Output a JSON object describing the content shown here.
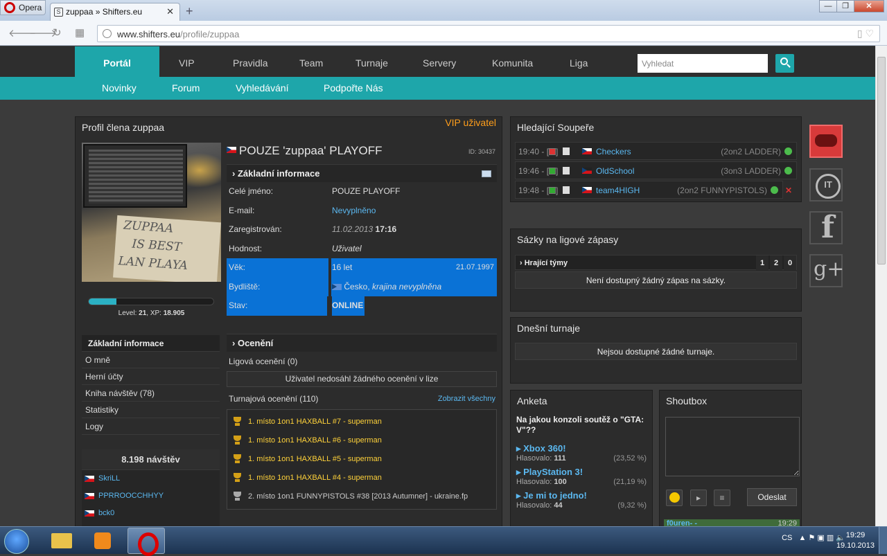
{
  "browser": {
    "opera_label": "Opera",
    "tab_title": "zuppaa » Shifters.eu",
    "tab_favicon": "S",
    "url_domain": "www.shifters.eu",
    "url_path": "/profile/zuppaa"
  },
  "nav": {
    "main": [
      "Portál",
      "VIP",
      "Pravidla",
      "Team",
      "Turnaje",
      "Servery",
      "Komunita",
      "Liga"
    ],
    "search_placeholder": "Vyhledat",
    "sub": [
      "Novinky",
      "Forum",
      "Vyhledávání",
      "Podpořte Nás"
    ]
  },
  "profile": {
    "header": "Profil člena zuppaa",
    "vip_label": "VIP uživatel",
    "display_title": "POUZE 'zuppaa' PLAYOFF",
    "id_text": "ID: 30437",
    "photo_text": [
      "ZUPPAA",
      "IS BEST",
      "LAN PLAYA"
    ],
    "xp_fraction": 0.22,
    "level_prefix": "Level:",
    "level": "21",
    "xp_prefix": ", XP:",
    "xp": "18.905",
    "menu": [
      "Základní informace",
      "O mně",
      "Herní účty",
      "Kniha návštěv (78)",
      "Statistiky",
      "Logy"
    ],
    "visits": {
      "title": "8.198 návštěv",
      "visitors": [
        "SkriLL",
        "PPRROOCCHHYY",
        "bck0"
      ]
    },
    "basic": {
      "title": "Základní informace",
      "rows": [
        {
          "k": "Celé jméno:",
          "v": "POUZE PLAYOFF"
        },
        {
          "k": "E-mail:",
          "v": "Nevyplněno"
        },
        {
          "k": "Zaregistrován:",
          "v": "11.02.2013",
          "v2": "17:16"
        },
        {
          "k": "Hodnost:",
          "v": "Uživatel"
        },
        {
          "k": "Věk:",
          "v": "16 let",
          "v2": "21.07.1997"
        },
        {
          "k": "Bydliště:",
          "v": "Česko,",
          "v2": "krajina nevyplněna"
        },
        {
          "k": "Stav:",
          "v": "ONLINE"
        }
      ]
    },
    "awards": {
      "title": "Ocenění",
      "league_title": "Ligová ocenění (0)",
      "league_empty": "Uživatel nedosáhl žádného ocenění v lize",
      "tournament_title": "Turnajová ocenění (110)",
      "show_all": "Zobrazit všechny",
      "items": [
        "1. místo 1on1 HAXBALL #7 - superman",
        "1. místo 1on1 HAXBALL #6 - superman",
        "1. místo 1on1 HAXBALL #5 - superman",
        "1. místo 1on1 HAXBALL #4 - superman",
        "2. místo 1on1 FUNNYPISTOLS #38 [2013 Autumner] - ukraine.fp"
      ]
    }
  },
  "opponents": {
    "title": "Hledající Soupeře",
    "rows": [
      {
        "time": "19:40 -",
        "team": "Checkers",
        "type": "(2on2 LADDER)"
      },
      {
        "time": "19:46 -",
        "team": "OldSchool",
        "type": "(3on3 LADDER)"
      },
      {
        "time": "19:48 -",
        "team": "team4HIGH",
        "type": "(2on2 FUNNYPISTOLS)"
      }
    ]
  },
  "bets": {
    "title": "Sázky na ligové zápasy",
    "teams_label": "Hrající týmy",
    "cols": [
      "1",
      "2",
      "0"
    ],
    "empty": "Není dostupný žádný zápas na sázky."
  },
  "tournaments": {
    "title": "Dnešní turnaje",
    "empty": "Nejsou dostupné žádné turnaje."
  },
  "poll": {
    "title": "Anketa",
    "question": "Na jakou konzoli soutěž o \"GTA: V\"??",
    "votes_label": "Hlasovalo:",
    "options": [
      {
        "a": "Xbox 360!",
        "n": "111",
        "p": "(23,52 %)"
      },
      {
        "a": "PlayStation 3!",
        "n": "100",
        "p": "(21,19 %)"
      },
      {
        "a": "Je mi to jedno!",
        "n": "44",
        "p": "(9,32 %)"
      }
    ]
  },
  "shoutbox": {
    "title": "Shoutbox",
    "send_label": "Odeslat",
    "last_user": "f0uren- -",
    "last_time": "19:29"
  },
  "taskbar": {
    "lang": "CS",
    "time": "19:29",
    "date": "19.10.2013"
  },
  "colors": {
    "accent": "#1ea6aa",
    "vip": "#ff9e1b",
    "link": "#5bb8f0",
    "selection": "#0a72d6"
  }
}
